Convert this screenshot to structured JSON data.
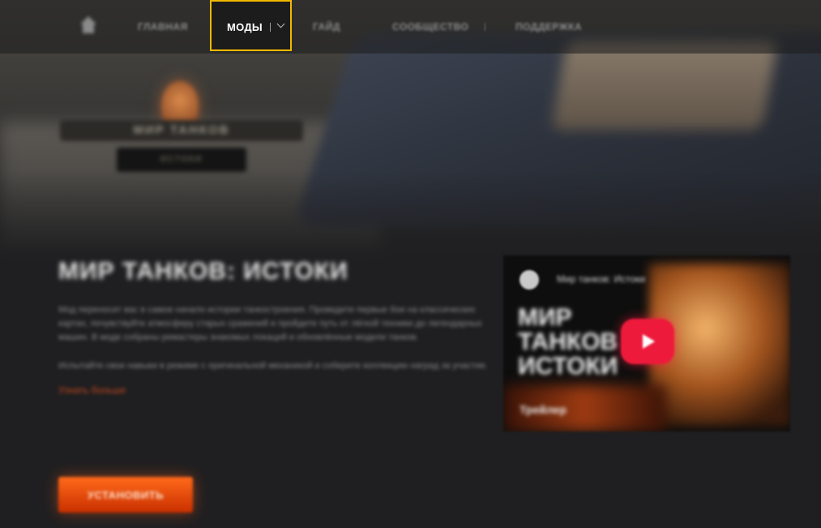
{
  "nav": {
    "home_icon": "home-icon",
    "items": [
      {
        "label": "ГЛАВНАЯ"
      },
      {
        "label": "МОДЫ"
      },
      {
        "label": "ГАЙД"
      },
      {
        "label": "СООБЩЕСТВО"
      },
      {
        "label": "ПОДДЕРЖКА"
      }
    ],
    "active_label": "МОДЫ",
    "dropdown_icon": "chevron-down-icon",
    "accent_color": "#f2b800"
  },
  "hero": {
    "logo_name": "МИР ТАНКОВ",
    "logo_sub": "ИСТОКИ"
  },
  "main": {
    "title": "МИР ТАНКОВ: ИСТОКИ",
    "paragraph1": "Мод переносит вас в самое начало истории танкостроения. Проведите первые бои на классических картах, почувствуйте атмосферу старых сражений и пройдите путь от лёгкой техники до легендарных машин. В моде собраны ремастеры знакомых локаций и обновлённые модели танков.",
    "paragraph2": "Испытайте свои навыки в режиме с оригинальной механикой и соберите коллекцию наград за участие.",
    "more_link": "Узнать больше",
    "cta_label": "УСТАНОВИТЬ",
    "cta_color": "#ff5a14"
  },
  "video": {
    "channel_title": "Мир танков: Истоки",
    "headline": "МИР ТАНКОВ ИСТОКИ",
    "badge": "Трейлер",
    "play_icon": "play-icon",
    "play_color": "#ee1a3c"
  }
}
